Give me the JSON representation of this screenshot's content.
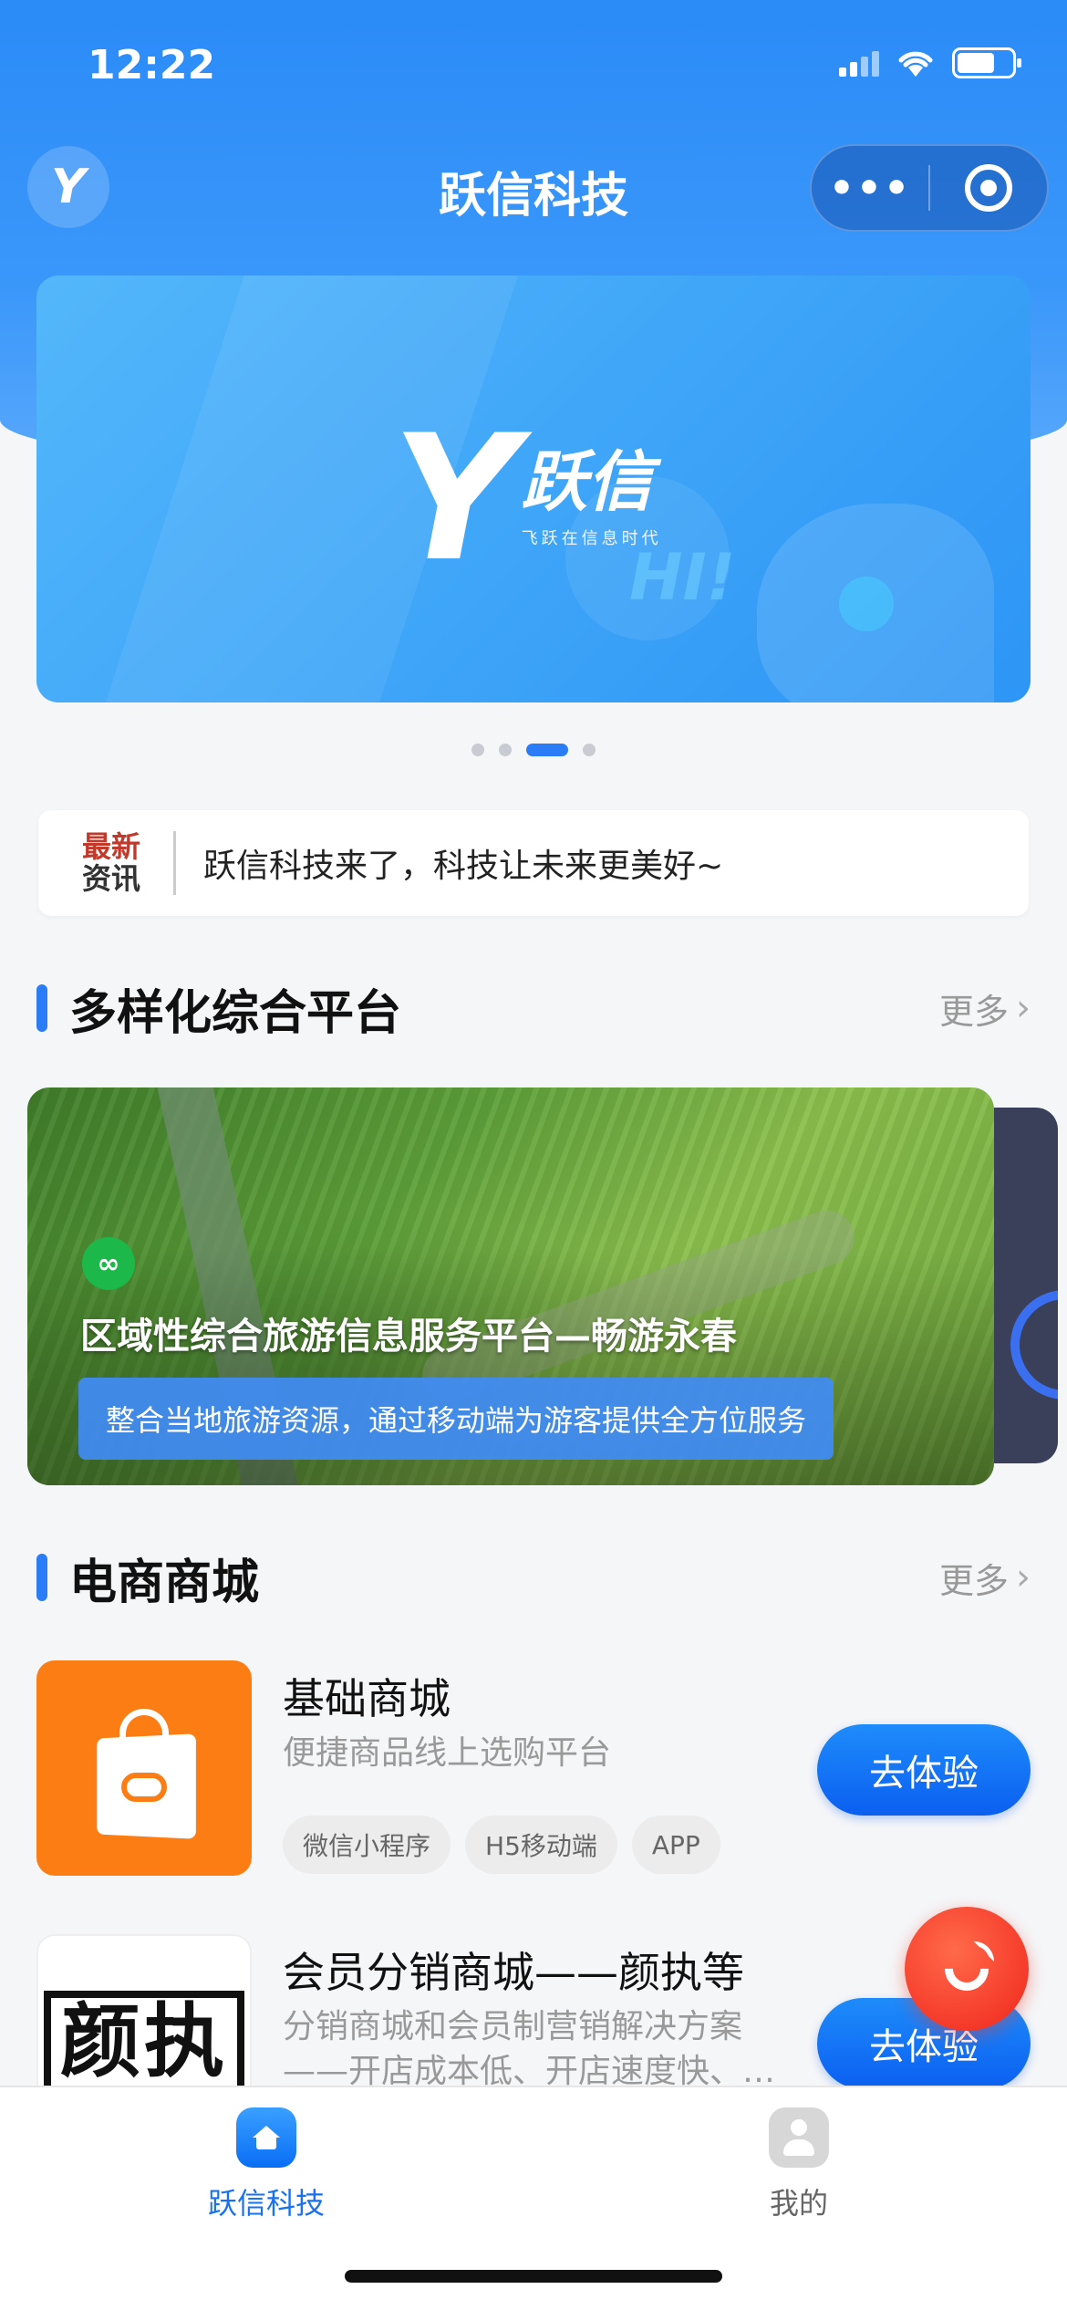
{
  "status": {
    "time": "12:22"
  },
  "nav": {
    "logo_letter": "Y",
    "title": "跃信科技",
    "more": "•••"
  },
  "banner": {
    "brand": "跃信",
    "slogan": "飞跃在信息时代",
    "hi": "HI!",
    "active_slide": 3,
    "slide_count": 4
  },
  "news": {
    "badge_line1": "最新",
    "badge_line2": "资讯",
    "text": "跃信科技来了，科技让未来更美好~"
  },
  "section1": {
    "title": "多样化综合平台",
    "more": "更多"
  },
  "platform_card": {
    "title": "区域性综合旅游信息服务平台—畅游永春",
    "desc": "整合当地旅游资源，通过移动端为游客提供全方位服务",
    "badge_icon": "link-icon"
  },
  "section2": {
    "title": "电商商城",
    "more": "更多"
  },
  "products": [
    {
      "title": "基础商城",
      "subtitle": "便捷商品线上选购平台",
      "tags": [
        "微信小程序",
        "H5移动端",
        "APP"
      ],
      "button": "去体验",
      "image_icon": "shopping-bag-icon"
    },
    {
      "title": "会员分销商城——颜执等",
      "subtitle": "分销商城和会员制营销解决方案——开店成本低、开店速度快、…",
      "logo_text": "颜执",
      "button": "去体验"
    }
  ],
  "tabbar": {
    "tabs": [
      {
        "label": "跃信科技",
        "icon": "home-icon",
        "active": true
      },
      {
        "label": "我的",
        "icon": "user-icon",
        "active": false
      }
    ]
  },
  "colors": {
    "primary": "#2b7cf7",
    "call": "#f53a2a",
    "orange": "#fb7d14"
  }
}
